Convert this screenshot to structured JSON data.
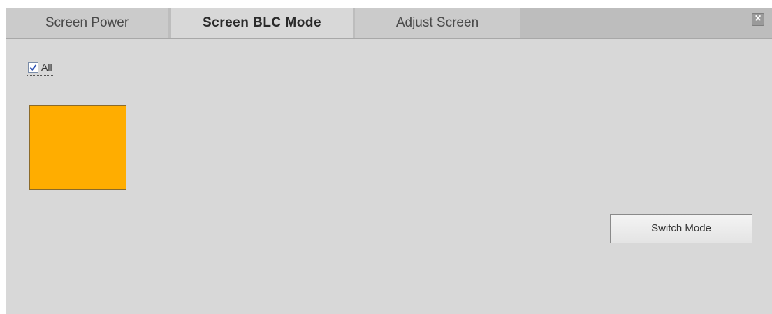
{
  "tabs": [
    {
      "label": "Screen Power"
    },
    {
      "label": "Screen BLC Mode"
    },
    {
      "label": "Adjust Screen"
    }
  ],
  "close_icon": "×",
  "all_checkbox": {
    "label": "All",
    "checked": true
  },
  "screen_block": {
    "color": "#FFAD00"
  },
  "switch_mode_label": "Switch Mode",
  "colors": {
    "tab_active_bg": "#d8d8d8",
    "panel_bg": "#d8d8d8",
    "tabbar_bg": "#bdbdbd"
  }
}
